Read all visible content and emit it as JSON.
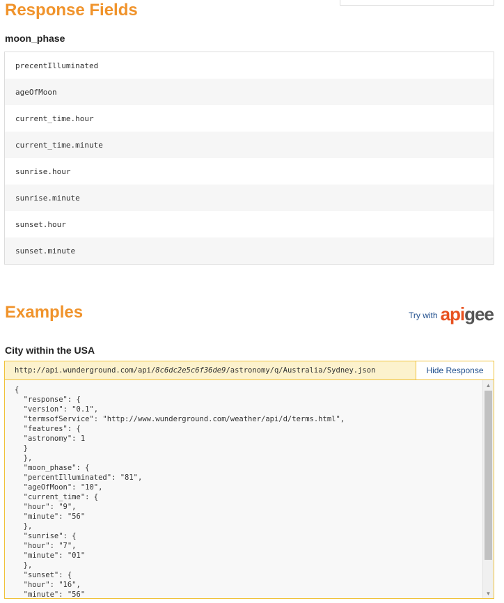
{
  "response_section": {
    "title": "Response Fields",
    "group": "moon_phase",
    "fields": [
      "precentIlluminated",
      "ageOfMoon",
      "current_time.hour",
      "current_time.minute",
      "sunrise.hour",
      "sunrise.minute",
      "sunset.hour",
      "sunset.minute"
    ]
  },
  "examples_section": {
    "title": "Examples",
    "try_with_label": "Try with",
    "apigee_part1": "api",
    "apigee_part2": "gee",
    "example_title": "City within the USA",
    "url_prefix": "http://api.wunderground.com/api/",
    "url_key": "8c6dc2e5c6f36de9",
    "url_suffix": "/astronomy/q/Australia/Sydney.json",
    "hide_response_label": "Hide Response",
    "code_lines": [
      "{",
      "  \"response\": {",
      "  \"version\": \"0.1\",",
      "  \"termsofService\": \"http://www.wunderground.com/weather/api/d/terms.html\",",
      "  \"features\": {",
      "  \"astronomy\": 1",
      "  }",
      "  },",
      "  \"moon_phase\": {",
      "  \"percentIlluminated\": \"81\",",
      "  \"ageOfMoon\": \"10\",",
      "  \"current_time\": {",
      "  \"hour\": \"9\",",
      "  \"minute\": \"56\"",
      "  },",
      "  \"sunrise\": {",
      "  \"hour\": \"7\",",
      "  \"minute\": \"01\"",
      "  },",
      "  \"sunset\": {",
      "  \"hour\": \"16\",",
      "  \"minute\": \"56\""
    ]
  },
  "colors": {
    "heading_orange": "#f0932b",
    "link_blue": "#1f4e8c",
    "url_bar_bg": "#fcf2cd",
    "url_bar_border": "#f0c23a",
    "apigee_orange": "#e8511f"
  }
}
